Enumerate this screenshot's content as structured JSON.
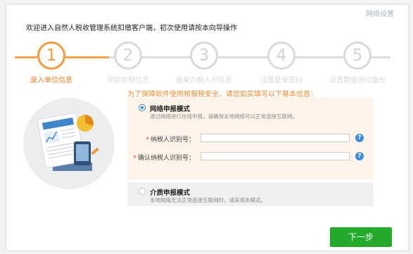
{
  "window": {
    "network_settings_link": "网络设置",
    "title": "欢迎进入自然人税收管理系统扣缴客户端，初次使用请按本向导操作"
  },
  "steps": [
    {
      "number": "1",
      "label": "录入单位信息",
      "state": "active"
    },
    {
      "number": "2",
      "label": "获取办税信息",
      "state": "inactive"
    },
    {
      "number": "3",
      "label": "备案办税人员信息",
      "state": "inactive"
    },
    {
      "number": "4",
      "label": "设置登录密码",
      "state": "inactive"
    },
    {
      "number": "5",
      "label": "设置数据自动备份",
      "state": "inactive"
    }
  ],
  "notice": "为了保障软件使用和报税安全，请您如实填写以下基本信息：",
  "modes": {
    "network": {
      "title": "网络申报模式",
      "desc": "通过网络进行在线申报，请确保本地网络可以正常连接互联网。",
      "selected": true
    },
    "media": {
      "title": "介质申报模式",
      "desc": "本地网络无法正常连接互联网时，请采用本模式。",
      "selected": false
    }
  },
  "fields": {
    "taxpayer_id": {
      "label": "纳税人识别号：",
      "value": "",
      "required": true
    },
    "confirm_taxpayer_id": {
      "label": "确认纳税人识别号：",
      "value": "",
      "required": true
    },
    "help_glyph": "?"
  },
  "buttons": {
    "next": "下一步"
  },
  "colors": {
    "accent_orange": "#f29a3a",
    "next_green": "#23aa2b",
    "help_blue": "#3a8de0"
  }
}
